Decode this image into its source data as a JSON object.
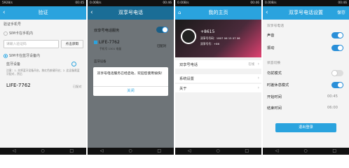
{
  "s1": {
    "status": "5928/s",
    "time": "00:45",
    "title": "验证",
    "phone_label": "验证手机号",
    "radio_sim_in": "SIM卡在手机内",
    "code_placeholder": "请输入验证码",
    "get_btn": "点击获取",
    "radio_sim_out": "SIM卡在蓝牙设备内",
    "bt_label": "蓝牙设备",
    "hint": "注意：1. 先将蓝牙设备开启，按红色按键开启；2. 此设备需蓝牙配对，然后",
    "device": "LIFE-7762",
    "device_status": "已配对"
  },
  "s2": {
    "status": "0.00B/s",
    "time": "00:46",
    "title": "双享号电话",
    "service": "双享号电话服务",
    "device": "LIFE-7762",
    "device_sub": "手机号 1301 电量",
    "device_status": "已配对",
    "bt": "蓝牙设备",
    "dialog_text": "双享号电话服务已经启动，欢迎您使用愉快！",
    "dialog_btn": "关闭"
  },
  "s3": {
    "status": "0.00B/s",
    "time": "00:46",
    "title": "我的主页",
    "num_label": "+8615",
    "line1": "双享号号码：1807 06 15 07 06",
    "line2": "双享号号：+86",
    "menu1": "双享号电话",
    "menu1_val": "在线",
    "menu2": "系统设置",
    "menu3": "关于"
  },
  "s4": {
    "status": "0.00B/s",
    "time": "00:46",
    "title": "双享号电话设置",
    "save": "保存",
    "sec1": "双享号电话",
    "sound": "声音",
    "vibrate": "振动",
    "sec2": "状态切换",
    "mode1": "勿扰模式",
    "mode2": "时差休息模式",
    "start_label": "开始时间",
    "start_val": "00:45",
    "end_label": "结束时间",
    "end_val": "06:00",
    "logout": "退出登录"
  }
}
